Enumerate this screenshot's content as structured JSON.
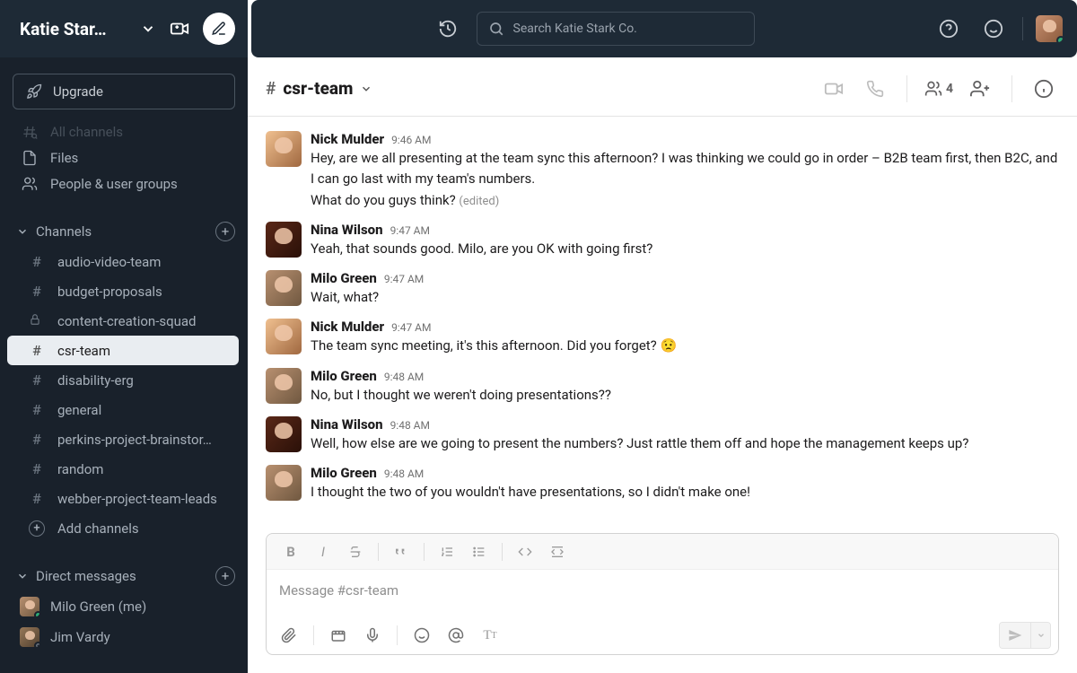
{
  "workspace": {
    "name": "Katie Star…"
  },
  "topbar": {
    "search_placeholder": "Search Katie Stark Co."
  },
  "sidebar": {
    "upgrade": "Upgrade",
    "nav": [
      {
        "label": "All channels"
      },
      {
        "label": "Files"
      },
      {
        "label": "People & user groups"
      }
    ],
    "channels_label": "Channels",
    "channels": [
      {
        "name": "audio-video-team",
        "private": false,
        "active": false
      },
      {
        "name": "budget-proposals",
        "private": false,
        "active": false
      },
      {
        "name": "content-creation-squad",
        "private": true,
        "active": false
      },
      {
        "name": "csr-team",
        "private": false,
        "active": true
      },
      {
        "name": "disability-erg",
        "private": false,
        "active": false
      },
      {
        "name": "general",
        "private": false,
        "active": false
      },
      {
        "name": "perkins-project-brainstor…",
        "private": false,
        "active": false
      },
      {
        "name": "random",
        "private": false,
        "active": false
      },
      {
        "name": "webber-project-team-leads",
        "private": false,
        "active": false
      }
    ],
    "add_channels": "Add channels",
    "dms_label": "Direct messages",
    "dms": [
      {
        "name": "Milo Green (me)",
        "online": true,
        "avatar": "av-milo"
      },
      {
        "name": "Jim Vardy",
        "online": false,
        "avatar": "av-jim"
      }
    ]
  },
  "header": {
    "channel": "csr-team",
    "member_count": "4"
  },
  "messages": [
    {
      "author": "Nick Mulder",
      "time": "9:46 AM",
      "avatar": "av-nick",
      "text": "Hey, are we all presenting at the team sync this afternoon? I was thinking we could go in order – B2B team first, then B2C, and I can go last with my team's numbers.\nWhat do you guys think?",
      "edited": true
    },
    {
      "author": "Nina Wilson",
      "time": "9:47 AM",
      "avatar": "av-nina",
      "text": "Yeah, that sounds good. Milo, are you OK with going first?"
    },
    {
      "author": "Milo Green",
      "time": "9:47 AM",
      "avatar": "av-milo",
      "text": "Wait, what?"
    },
    {
      "author": "Nick Mulder",
      "time": "9:47 AM",
      "avatar": "av-nick",
      "text": "The team sync meeting, it's this afternoon. Did you forget? 😟"
    },
    {
      "author": "Milo Green",
      "time": "9:48 AM",
      "avatar": "av-milo",
      "text": "No, but I thought we weren't doing presentations??"
    },
    {
      "author": "Nina Wilson",
      "time": "9:48 AM",
      "avatar": "av-nina",
      "text": "Well, how else are we going to present the numbers? Just rattle them off and hope the management keeps up?"
    },
    {
      "author": "Milo Green",
      "time": "9:48 AM",
      "avatar": "av-milo",
      "text": "I thought the two of you wouldn't have presentations, so I didn't make one!"
    }
  ],
  "composer": {
    "placeholder": "Message #csr-team",
    "edited_label": "(edited)"
  }
}
